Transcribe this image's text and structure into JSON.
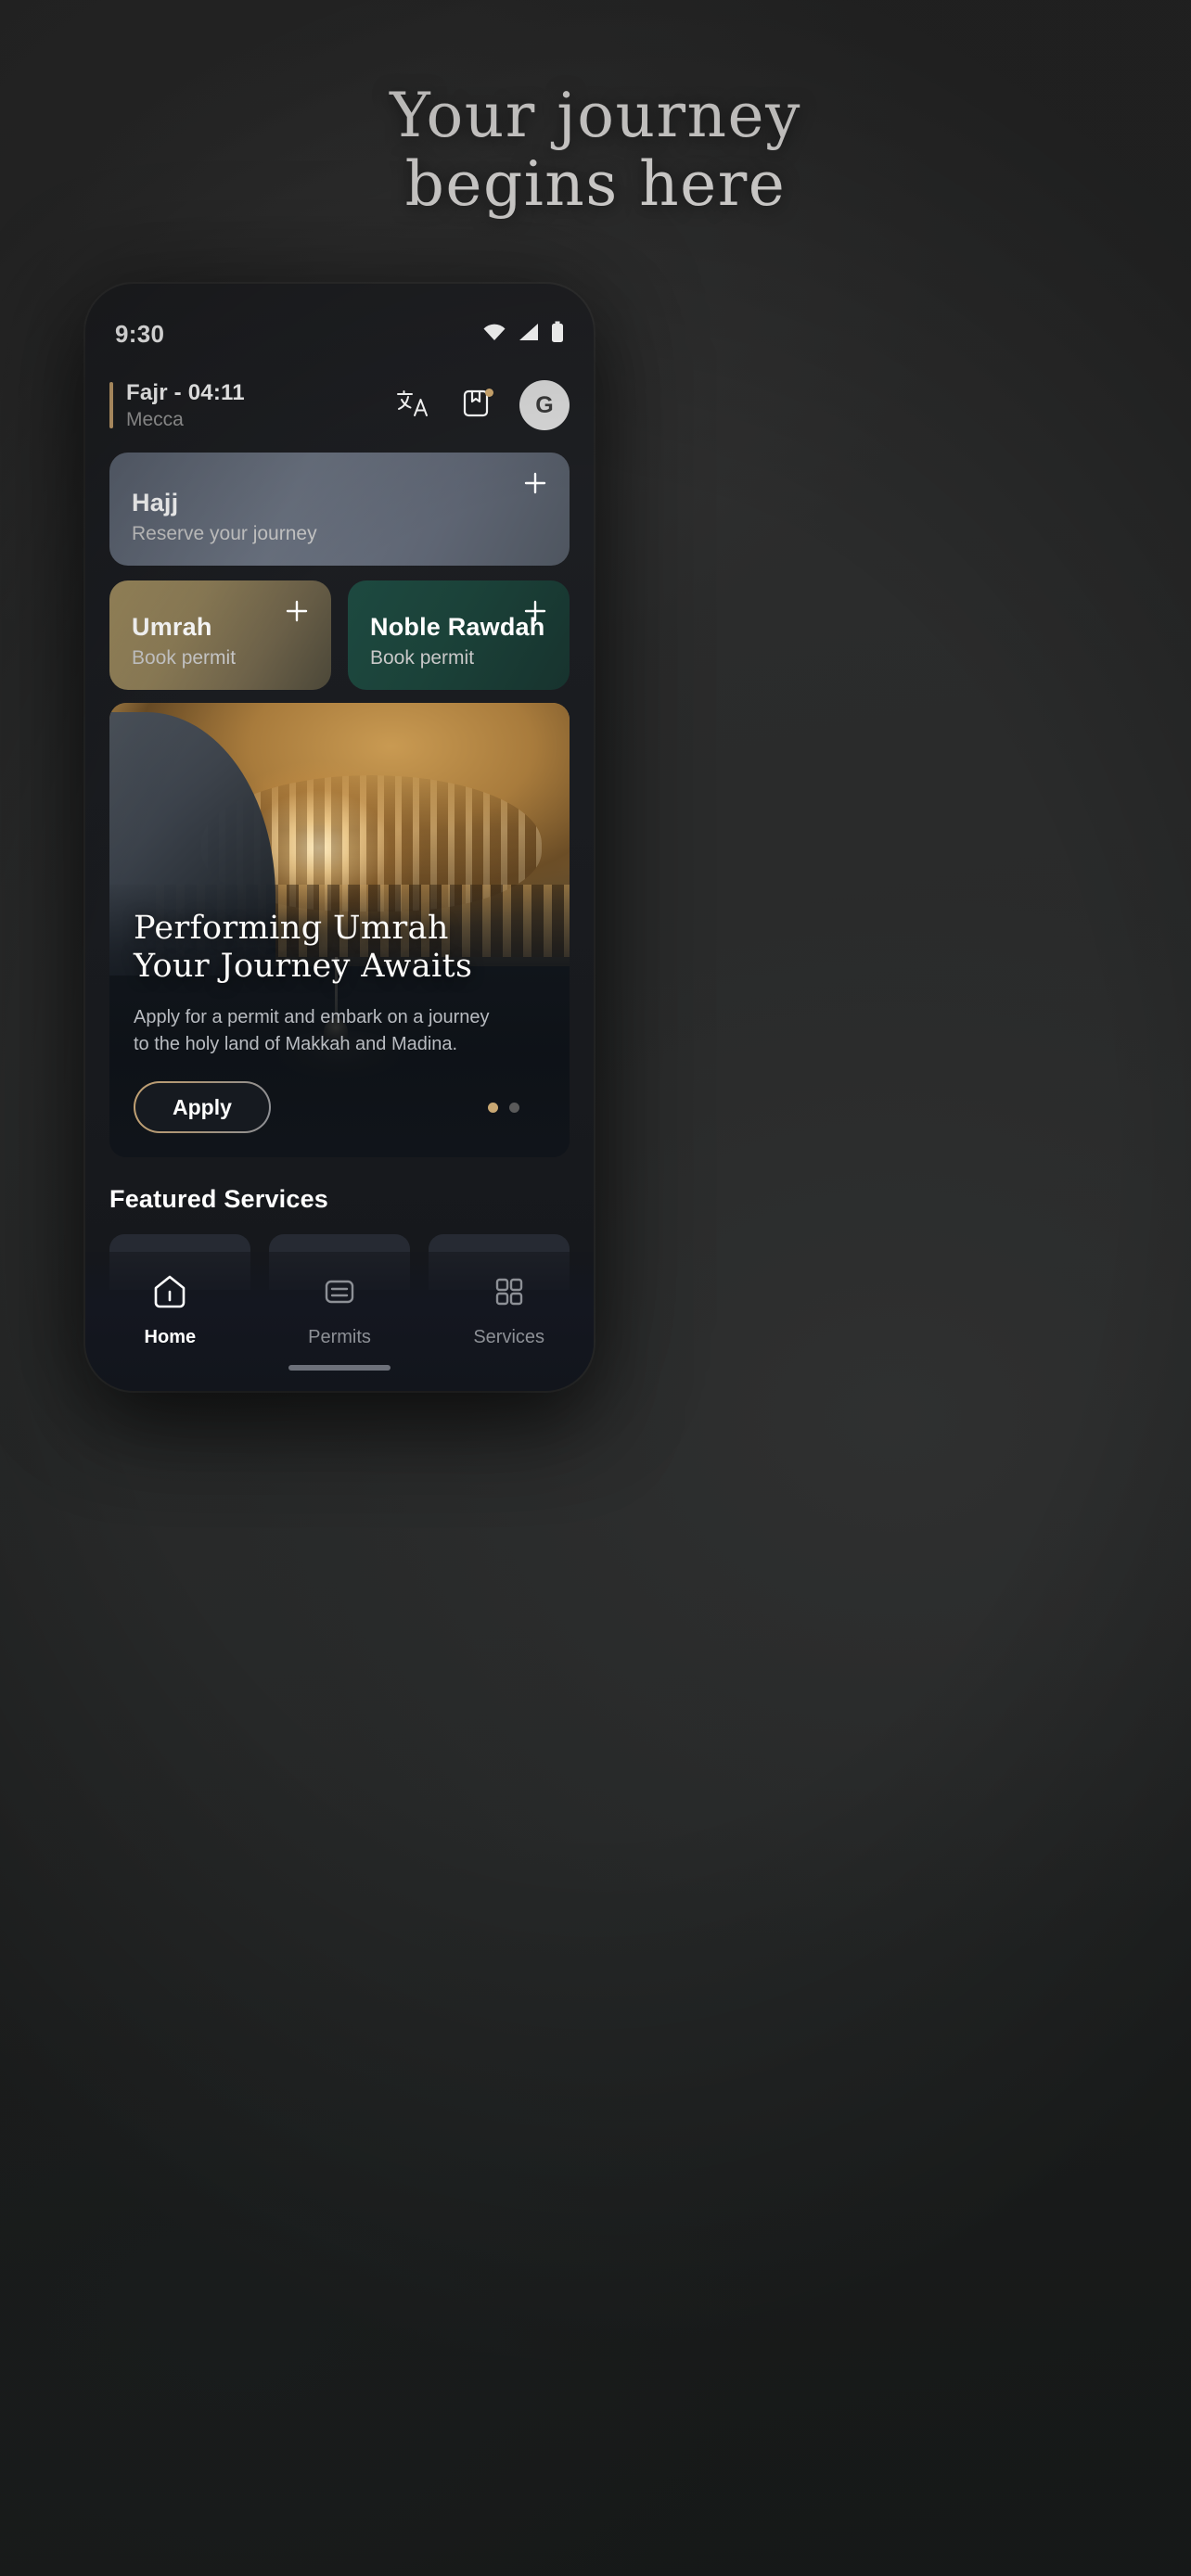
{
  "hero": {
    "headline_line1": "Your journey",
    "headline_line2": "begins here"
  },
  "phone": {
    "status_bar": {
      "time": "9:30",
      "icons": [
        "wifi-icon",
        "cellular-signal-icon",
        "battery-icon"
      ]
    },
    "app_header": {
      "prayer_name_time": "Fajr - 04:11",
      "city": "Mecca",
      "accent_color": "#c7a26f",
      "translate_icon": "translate-icon",
      "bookmark_icon": "bookmark-icon",
      "notification_dot_color": "#cfa96f",
      "avatar_initial": "G"
    },
    "cards": [
      {
        "title": "Hajj",
        "subtitle": "Reserve your journey",
        "action_icon": "plus-icon"
      },
      {
        "title": "Umrah",
        "subtitle": "Book permit",
        "action_icon": "plus-icon"
      },
      {
        "title": "Noble Rawdah",
        "subtitle": "Book permit",
        "action_icon": "plus-icon"
      }
    ],
    "banner": {
      "title_line1": "Performing Umrah",
      "title_line2": "Your Journey Awaits",
      "description_line1": "Apply for a permit and embark on a journey",
      "description_line2": "to the holy land of Makkah and Madina.",
      "cta_label": "Apply",
      "pagination": {
        "count": 2,
        "active_index": 0,
        "active_color": "#c9a873",
        "inactive_color": "#5a5a5a"
      }
    },
    "featured": {
      "section_title": "Featured Services",
      "tiles": [
        "",
        "",
        ""
      ]
    },
    "bottom_nav": {
      "items": [
        {
          "label": "Home",
          "icon": "home-icon",
          "active": true
        },
        {
          "label": "Permits",
          "icon": "permits-card-icon",
          "active": false
        },
        {
          "label": "Services",
          "icon": "grid-squares-icon",
          "active": false
        }
      ]
    }
  }
}
